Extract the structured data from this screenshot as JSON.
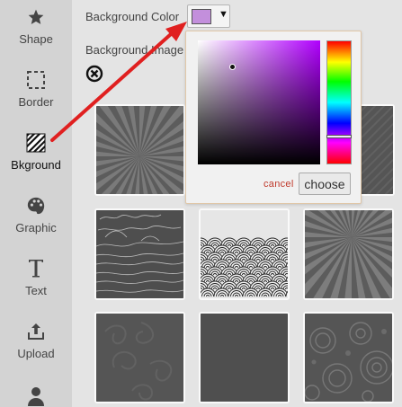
{
  "sidebar": {
    "items": [
      {
        "label": "Shape",
        "icon": "star-icon"
      },
      {
        "label": "Border",
        "icon": "dashed-square-icon"
      },
      {
        "label": "Bkground",
        "icon": "hatched-square-icon"
      },
      {
        "label": "Graphic",
        "icon": "palette-icon"
      },
      {
        "label": "Text",
        "icon": "text-t-icon"
      },
      {
        "label": "Upload",
        "icon": "upload-icon"
      },
      {
        "label": "",
        "icon": "user-icon"
      }
    ],
    "active": "Bkground"
  },
  "main": {
    "bg_color_label": "Background Color",
    "bg_color_value": "#c38fdc",
    "bg_image_label": "Background Image",
    "clear_icon": "clear-circle-x-icon"
  },
  "color_picker": {
    "cancel_label": "cancel",
    "choose_label": "choose"
  },
  "thumbnails": [
    {
      "pattern": "rays"
    },
    {
      "pattern": "diagonal-stripes"
    },
    {
      "pattern": "sketch-landscape"
    },
    {
      "pattern": "waves"
    },
    {
      "pattern": "rays"
    },
    {
      "pattern": "floral"
    },
    {
      "pattern": "plain-dark"
    },
    {
      "pattern": "circles"
    }
  ],
  "colors": {
    "annotation_arrow": "#e02020",
    "sidebar_bg": "#d3d3d3",
    "main_bg": "#e4e4e4",
    "cancel_text": "#c0392b"
  }
}
